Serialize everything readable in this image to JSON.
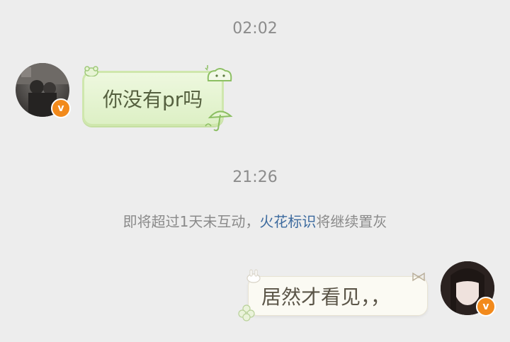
{
  "messages": [
    {
      "type": "time",
      "text": "02:02"
    },
    {
      "type": "incoming",
      "text": "你没有pr吗",
      "badge": "v"
    },
    {
      "type": "time",
      "text": "21:26"
    },
    {
      "type": "notice",
      "text_before": "即将超过1天未互动，",
      "link": "火花标识",
      "text_after": "将继续置灰"
    },
    {
      "type": "outgoing",
      "text": "居然才看见，，",
      "badge": "v"
    }
  ],
  "colors": {
    "background": "#ededed",
    "incoming_bubble": "#ddf0c5",
    "outgoing_bubble": "#fbfaf3",
    "link": "#3c6a9e",
    "badge": "#f28a1c"
  },
  "icons": [
    "avatar-photo",
    "verified-badge-icon",
    "cat-sticker-icon",
    "umbrella-sticker-icon",
    "bunny-sticker-icon",
    "bow-sticker-icon",
    "clover-sticker-icon"
  ]
}
